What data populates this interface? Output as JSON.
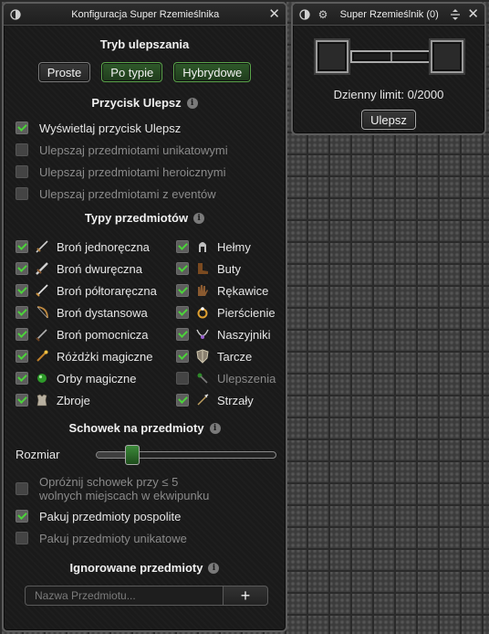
{
  "config": {
    "title": "Konfiguracja Super Rzemieślnika",
    "upgrade_mode": {
      "title": "Tryb ulepszania",
      "buttons": [
        {
          "label": "Proste",
          "active": false
        },
        {
          "label": "Po typie",
          "active": true
        },
        {
          "label": "Hybrydowe",
          "active": true
        }
      ]
    },
    "upgrade_button": {
      "title": "Przycisk Ulepsz",
      "options": [
        {
          "label": "Wyświetlaj przycisk Ulepsz",
          "checked": true,
          "enabled": true
        },
        {
          "label": "Ulepszaj przedmiotami unikatowymi",
          "checked": false,
          "enabled": false
        },
        {
          "label": "Ulepszaj przedmiotami heroicznymi",
          "checked": false,
          "enabled": false
        },
        {
          "label": "Ulepszaj przedmiotami z eventów",
          "checked": false,
          "enabled": false
        }
      ]
    },
    "item_types": {
      "title": "Typy przedmiotów",
      "left": [
        {
          "label": "Broń jednoręczna",
          "icon": "sword-icon",
          "checked": true
        },
        {
          "label": "Broń dwuręczna",
          "icon": "greatsword-icon",
          "checked": true
        },
        {
          "label": "Broń półtoraręczna",
          "icon": "longsword-icon",
          "checked": true
        },
        {
          "label": "Broń dystansowa",
          "icon": "bow-icon",
          "checked": true
        },
        {
          "label": "Broń pomocnicza",
          "icon": "dagger-icon",
          "checked": true
        },
        {
          "label": "Różdżki magiczne",
          "icon": "wand-icon",
          "checked": true
        },
        {
          "label": "Orby magiczne",
          "icon": "orb-icon",
          "checked": true
        },
        {
          "label": "Zbroje",
          "icon": "armor-icon",
          "checked": true
        }
      ],
      "right": [
        {
          "label": "Hełmy",
          "icon": "helmet-icon",
          "checked": true
        },
        {
          "label": "Buty",
          "icon": "boots-icon",
          "checked": true
        },
        {
          "label": "Rękawice",
          "icon": "gloves-icon",
          "checked": true
        },
        {
          "label": "Pierścienie",
          "icon": "ring-icon",
          "checked": true
        },
        {
          "label": "Naszyjniki",
          "icon": "necklace-icon",
          "checked": true
        },
        {
          "label": "Tarcze",
          "icon": "shield-icon",
          "checked": true
        },
        {
          "label": "Ulepszenia",
          "icon": "upgrade-icon",
          "checked": false,
          "dim": true
        },
        {
          "label": "Strzały",
          "icon": "arrows-icon",
          "checked": true
        }
      ]
    },
    "stash": {
      "title": "Schowek na przedmioty",
      "size_label": "Rozmiar",
      "size_fraction": 0.2,
      "empty_line1": "Opróżnij schowek przy ≤ 5",
      "empty_line2": "wolnych miejscach w ekwipunku",
      "empty_checked": false,
      "pack_common": "Pakuj przedmioty pospolite",
      "pack_common_checked": true,
      "pack_unique": "Pakuj przedmioty unikatowe",
      "pack_unique_checked": false
    },
    "ignored": {
      "title": "Ignorowane przedmioty",
      "placeholder": "Nazwa Przedmiotu...",
      "add_label": "+"
    }
  },
  "crafter": {
    "title": "Super Rzemieślnik",
    "count": "(0)",
    "daily_limit": "Dzienny limit: 0/2000",
    "upgrade_label": "Ulepsz"
  },
  "colors": {
    "active_green": "#2f5a2a",
    "check_green": "#4cd43a",
    "panel_bg": "#1a1a1a"
  }
}
